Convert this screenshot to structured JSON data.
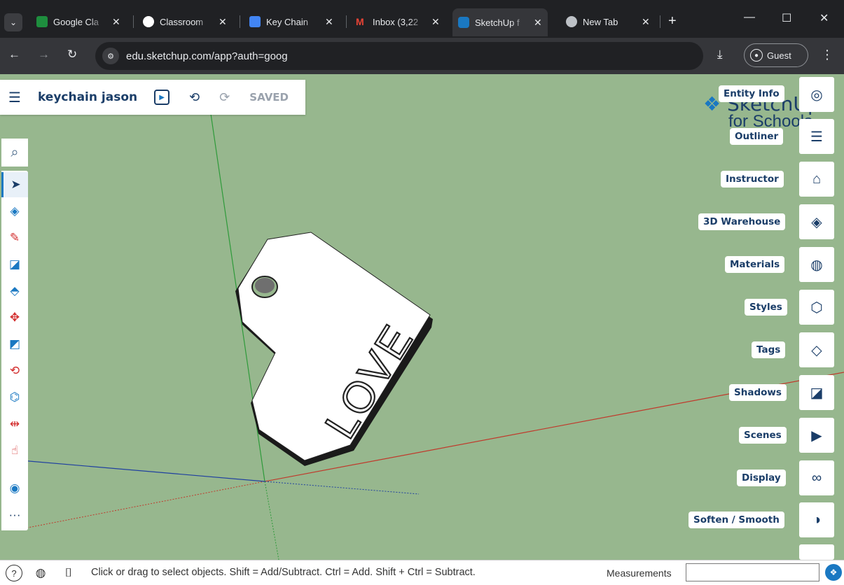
{
  "browser": {
    "tabs": [
      {
        "title": "Google Cla",
        "favicon_color": "#1e8e3e"
      },
      {
        "title": "Classroom",
        "favicon_color": "#ffffff"
      },
      {
        "title": "Key Chain",
        "favicon_color": "#4285f4"
      },
      {
        "title": "Inbox (3,22",
        "favicon_color": "#ea4335"
      },
      {
        "title": "SketchUp f",
        "favicon_color": "#1a78c2",
        "active": true
      },
      {
        "title": "New Tab",
        "favicon_color": "#bdc1c6"
      }
    ],
    "close_glyph": "✕",
    "new_tab_glyph": "+",
    "url": "edu.sketchup.com/app?auth=goog",
    "profile_label": "Guest"
  },
  "app": {
    "doc_title": "keychain jason",
    "saved_label": "SAVED",
    "logo_text": "SketchUp",
    "logo_sub": "for Schools"
  },
  "left_tools": [
    {
      "name": "select-icon",
      "glyph": "➤",
      "color": "#1a3d68",
      "selected": true
    },
    {
      "name": "eraser-icon",
      "glyph": "◈",
      "color": "#1a78c2"
    },
    {
      "name": "pencil-icon",
      "glyph": "✎",
      "color": "#d32f2f"
    },
    {
      "name": "rectangle-icon",
      "glyph": "◪",
      "color": "#1a78c2"
    },
    {
      "name": "push-pull-icon",
      "glyph": "⬘",
      "color": "#1a78c2"
    },
    {
      "name": "move-icon",
      "glyph": "✥",
      "color": "#d32f2f"
    },
    {
      "name": "scale-icon",
      "glyph": "◩",
      "color": "#1a78c2"
    },
    {
      "name": "rotate-icon",
      "glyph": "⟲",
      "color": "#d32f2f"
    },
    {
      "name": "paint-bucket-icon",
      "glyph": "⌬",
      "color": "#1a78c2"
    },
    {
      "name": "tape-measure-icon",
      "glyph": "⇹",
      "color": "#d32f2f"
    },
    {
      "name": "orbit-icon",
      "glyph": "☝",
      "color": "#d32f2f"
    },
    {
      "name": "section-icon",
      "glyph": "◉",
      "color": "#1a78c2"
    },
    {
      "name": "more-tools-icon",
      "glyph": "···",
      "color": "#1a3d68"
    }
  ],
  "right_panels": [
    {
      "label": "Entity Info",
      "icon": "entity-info-icon",
      "glyph": "◎"
    },
    {
      "label": "Outliner",
      "icon": "outliner-icon",
      "glyph": "☰"
    },
    {
      "label": "Instructor",
      "icon": "instructor-icon",
      "glyph": "🎓"
    },
    {
      "label": "3D Warehouse",
      "icon": "warehouse-icon",
      "glyph": "◈"
    },
    {
      "label": "Materials",
      "icon": "materials-icon",
      "glyph": "◍"
    },
    {
      "label": "Styles",
      "icon": "styles-icon",
      "glyph": "⬡"
    },
    {
      "label": "Tags",
      "icon": "tags-icon",
      "glyph": "◇"
    },
    {
      "label": "Shadows",
      "icon": "shadows-icon",
      "glyph": "◪"
    },
    {
      "label": "Scenes",
      "icon": "scenes-icon",
      "glyph": "🎬"
    },
    {
      "label": "Display",
      "icon": "display-icon",
      "glyph": "◯◯"
    },
    {
      "label": "Soften / Smooth",
      "icon": "soften-icon",
      "glyph": "◑"
    }
  ],
  "model": {
    "engraved_text": "LOVE"
  },
  "status": {
    "hint": "Click or drag to select objects. Shift = Add/Subtract. Ctrl = Add. Shift + Ctrl = Subtract.",
    "measurements_label": "Measurements",
    "measurements_value": ""
  },
  "colors": {
    "viewport_bg": "#97b78e",
    "brand_blue": "#1a3d68",
    "accent_blue": "#1a78c2",
    "axis_red": "#c0392b",
    "axis_green": "#2e9a3a",
    "axis_blue": "#2040a0"
  }
}
